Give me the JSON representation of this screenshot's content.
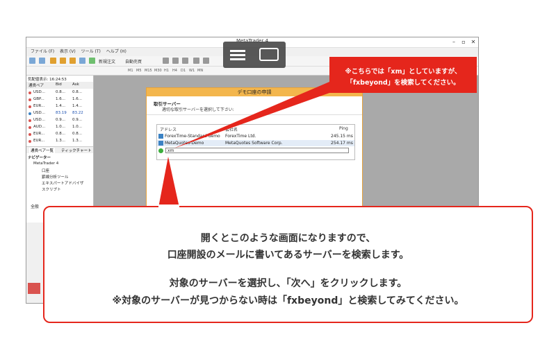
{
  "window": {
    "title": "MetaTrader 4",
    "minimize": "–",
    "maximize": "▫",
    "close": "✕",
    "menu": [
      "ファイル (F)",
      "表示 (V)",
      "ツール (T)",
      "ヘルプ (H)"
    ],
    "toolbar_labels": [
      "新規注文",
      "自動売買"
    ],
    "timeframes": [
      "M1",
      "M5",
      "M15",
      "M30",
      "H1",
      "H4",
      "D1",
      "W1",
      "MN"
    ]
  },
  "market_watch": {
    "header": "気配値表示: 16:24:53",
    "columns": [
      "通貨ペア",
      "Bid",
      "Ask"
    ],
    "rows": [
      {
        "symbol": "USD...",
        "bid": "0.8...",
        "ask": "0.8..."
      },
      {
        "symbol": "GBP...",
        "bid": "1.6...",
        "ask": "1.6..."
      },
      {
        "symbol": "EUR...",
        "bid": "1.4...",
        "ask": "1.4..."
      },
      {
        "symbol": "USD...",
        "bid": "83.19",
        "ask": "83.22"
      },
      {
        "symbol": "USD...",
        "bid": "0.9...",
        "ask": "0.9..."
      },
      {
        "symbol": "AUD...",
        "bid": "1.0...",
        "ask": "1.0..."
      },
      {
        "symbol": "EUR...",
        "bid": "0.8...",
        "ask": "0.8..."
      },
      {
        "symbol": "EUR...",
        "bid": "1.3...",
        "ask": "1.3..."
      }
    ],
    "tabs": [
      "通貨ペア一覧",
      "ティックチャート"
    ]
  },
  "navigator": {
    "title": "ナビゲーター",
    "items": [
      "MetaTrader 4",
      "口座",
      "罫線分析ツール",
      "エキスパートアドバイザ",
      "スクリプト"
    ]
  },
  "bottom_tab": "全般",
  "dialog": {
    "title": "デモ口座の申請",
    "heading": "取引サーバー",
    "subheading": "適切な取引サーバーを選択して下さい:",
    "columns": [
      "アドレス",
      "会社名",
      "Ping"
    ],
    "rows": [
      {
        "address": "ForexTime-Standard-demo",
        "company": "ForexTime Ltd.",
        "ping": "245.15 ms"
      },
      {
        "address": "MetaQuotes-Demo",
        "company": "MetaQuotes Software Corp.",
        "ping": "254.17 ms"
      }
    ],
    "search_value": "xm"
  },
  "red_note": {
    "line1": "※こちらでは「xm」としていますが、",
    "line2": "「fxbeyond」を検索してください。"
  },
  "callout": {
    "line1": "開くとこのような画面になりますので、",
    "line2": "口座開設のメールに書いてあるサーバーを検索します。",
    "line3": "対象のサーバーを選択し、「次へ」をクリックします。",
    "line4": "※対象のサーバーが見つからない時は「fxbeyond」と検索してみてください。"
  },
  "colors": {
    "accent_red": "#e5261c",
    "dialog_title": "#f3b64d",
    "chart_bg": "#a9a9a9"
  }
}
